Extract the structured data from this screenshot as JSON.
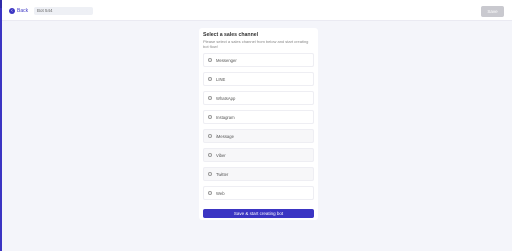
{
  "header": {
    "back_label": "Back",
    "bot_name": "Bot 544",
    "save_label": "Save"
  },
  "panel": {
    "title": "Select a sales channel",
    "subtitle": "Please select a sales channel from below and start creating bot flow!",
    "channels": [
      {
        "label": "Messenger",
        "style": "normal"
      },
      {
        "label": "LINE",
        "style": "normal"
      },
      {
        "label": "WhatsApp",
        "style": "normal"
      },
      {
        "label": "Instagram",
        "style": "normal"
      },
      {
        "label": "iMessage",
        "style": "muted"
      },
      {
        "label": "Viber",
        "style": "muted"
      },
      {
        "label": "Twitter",
        "style": "muted"
      },
      {
        "label": "Web",
        "style": "normal"
      }
    ],
    "cta_label": "Save & start creating bot"
  },
  "colors": {
    "accent": "#3b35c3",
    "background": "#f4f5fa",
    "disabled_button": "#c9c9cf"
  }
}
